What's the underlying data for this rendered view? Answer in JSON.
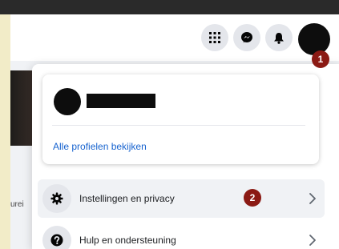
{
  "header": {
    "buttons": [
      {
        "name": "menu",
        "icon": "grid-icon"
      },
      {
        "name": "messenger",
        "icon": "messenger-icon"
      },
      {
        "name": "notifications",
        "icon": "bell-icon"
      }
    ],
    "account_avatar_icon": "avatar"
  },
  "annotations": {
    "first": "1",
    "second": "2"
  },
  "background": {
    "cut_text": "urei"
  },
  "profile_card": {
    "all_profiles_link": "Alle profielen bekijken"
  },
  "menu": {
    "items": [
      {
        "label": "Instellingen en privacy",
        "icon": "gear-icon"
      },
      {
        "label": "Hulp en ondersteuning",
        "icon": "question-icon"
      }
    ]
  },
  "colors": {
    "annotation": "#8b1a14",
    "link": "#1763cf",
    "hover_row": "#f0f2f5"
  }
}
